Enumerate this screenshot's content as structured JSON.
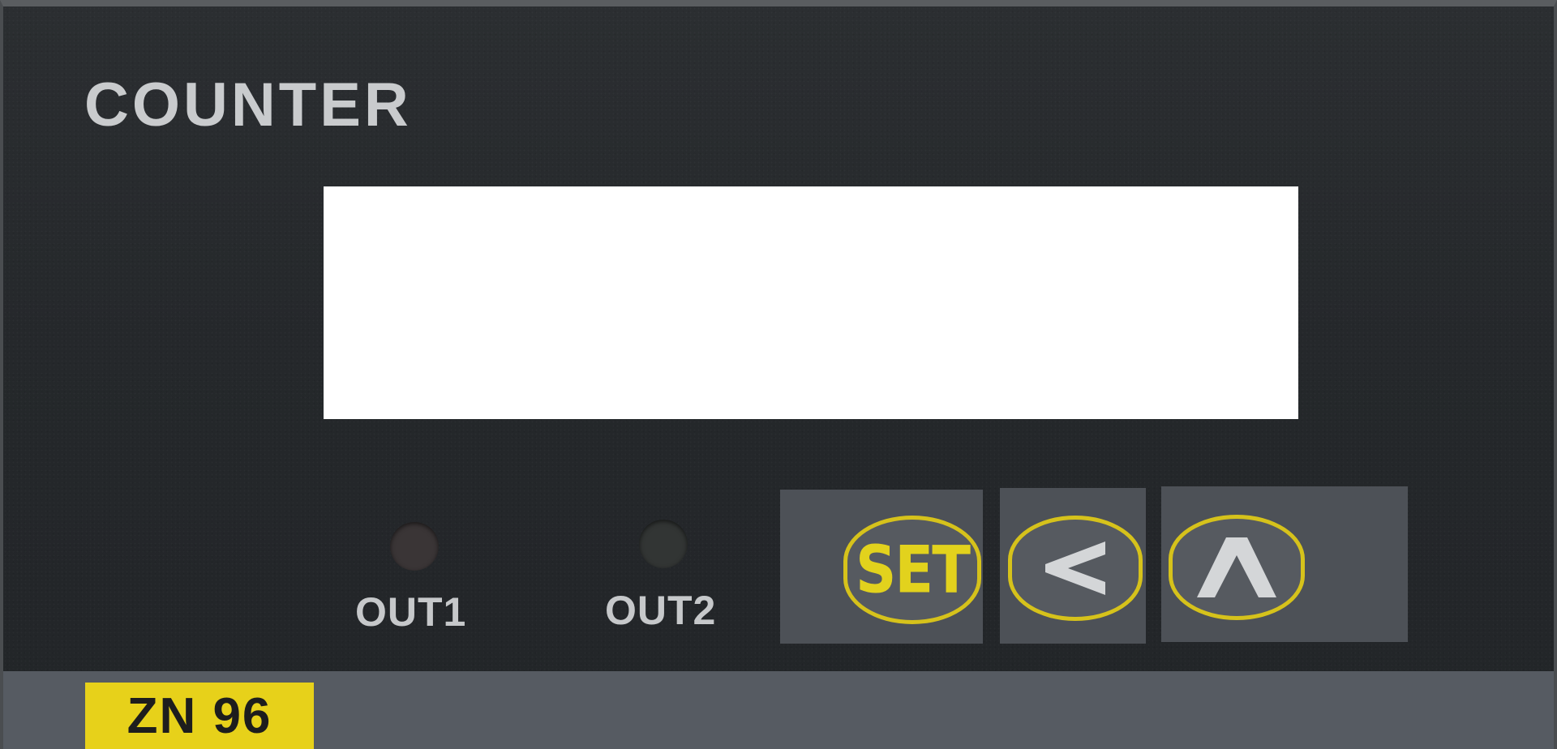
{
  "device": {
    "title": "COUNTER",
    "model": "ZN 96"
  },
  "indicators": [
    {
      "label": "OUT1"
    },
    {
      "label": "OUT2"
    }
  ],
  "keys": {
    "set_label": "SET",
    "left_icon": "chevron-left-icon",
    "up_icon": "chevron-up-icon"
  },
  "colors": {
    "panel": "#25282b",
    "key_border": "#d6c21b",
    "key_text": "#e2d21d",
    "model_tag": "#e7d11a",
    "text": "#c9cbcd"
  }
}
